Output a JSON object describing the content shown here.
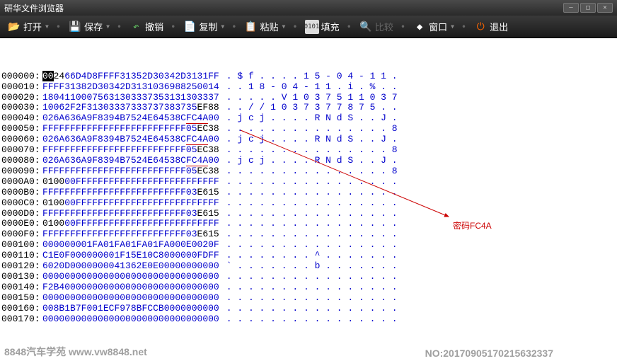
{
  "window": {
    "title": "研华文件浏览器"
  },
  "toolbar": {
    "open": "打开",
    "save": "保存",
    "undo": "撤销",
    "copy": "复制",
    "paste": "粘贴",
    "fill": "填充",
    "compare": "比较",
    "window": "窗口",
    "exit": "退出"
  },
  "annotation": {
    "label": "密码FC4A"
  },
  "watermarks": {
    "left": "8848汽车学苑  www.vw8848.net",
    "right": "NO:20170905170215632337"
  },
  "hex": {
    "rows": [
      {
        "off": "000000:",
        "b": [
          "0024",
          "66D4",
          "D8FF",
          "FF31",
          "352D",
          "3034",
          "2D31",
          "31FF"
        ],
        "a": ".$f....15-04-11."
      },
      {
        "off": "000010:",
        "b": [
          "FFFF",
          "3138",
          "2D30",
          "342D",
          "3131",
          "0369",
          "8825",
          "0014"
        ],
        "a": "..18-04-11.i.%.."
      },
      {
        "off": "000020:",
        "b": [
          "1804",
          "1100",
          "0756",
          "3130",
          "3337",
          "3531",
          "3130",
          "3337"
        ],
        "a": ".....V1037511037"
      },
      {
        "off": "000030:",
        "b": [
          "1006",
          "2F2F",
          "3130",
          "3337",
          "3337",
          "3738",
          "3735",
          "EF88"
        ],
        "a": "..//1037377875.."
      },
      {
        "off": "000040:",
        "b": [
          "026A",
          "636A",
          "9F83",
          "94B7",
          "524E",
          "6453",
          "8CFC",
          "4A00"
        ],
        "a": ".jcj....RNdS..J."
      },
      {
        "off": "000050:",
        "b": [
          "FFFF",
          "FFFF",
          "FFFF",
          "FFFF",
          "FFFF",
          "FFFF",
          "FF05",
          "EC38"
        ],
        "a": "...............8"
      },
      {
        "off": "000060:",
        "b": [
          "026A",
          "636A",
          "9F83",
          "94B7",
          "524E",
          "6453",
          "8CFC",
          "4A00"
        ],
        "a": ".jcj....RNdS..J."
      },
      {
        "off": "000070:",
        "b": [
          "FFFF",
          "FFFF",
          "FFFF",
          "FFFF",
          "FFFF",
          "FFFF",
          "FF05",
          "EC38"
        ],
        "a": "...............8"
      },
      {
        "off": "000080:",
        "b": [
          "026A",
          "636A",
          "9F83",
          "94B7",
          "524E",
          "6453",
          "8CFC",
          "4A00"
        ],
        "a": ".jcj....RNdS..J."
      },
      {
        "off": "000090:",
        "b": [
          "FFFF",
          "FFFF",
          "FFFF",
          "FFFF",
          "FFFF",
          "FFFF",
          "FF05",
          "EC38"
        ],
        "a": "...............8"
      },
      {
        "off": "0000A0:",
        "b": [
          "0100",
          "00FF",
          "FFFF",
          "FFFF",
          "FFFF",
          "FFFF",
          "FFFF",
          "FFFF"
        ],
        "a": "................"
      },
      {
        "off": "0000B0:",
        "b": [
          "FFFF",
          "FFFF",
          "FFFF",
          "FFFF",
          "FFFF",
          "FFFF",
          "FF03",
          "E615"
        ],
        "a": "................"
      },
      {
        "off": "0000C0:",
        "b": [
          "0100",
          "00FF",
          "FFFF",
          "FFFF",
          "FFFF",
          "FFFF",
          "FFFF",
          "FFFF"
        ],
        "a": "................"
      },
      {
        "off": "0000D0:",
        "b": [
          "FFFF",
          "FFFF",
          "FFFF",
          "FFFF",
          "FFFF",
          "FFFF",
          "FF03",
          "E615"
        ],
        "a": "................"
      },
      {
        "off": "0000E0:",
        "b": [
          "0100",
          "00FF",
          "FFFF",
          "FFFF",
          "FFFF",
          "FFFF",
          "FFFF",
          "FFFF"
        ],
        "a": "................"
      },
      {
        "off": "0000F0:",
        "b": [
          "FFFF",
          "FFFF",
          "FFFF",
          "FFFF",
          "FFFF",
          "FFFF",
          "FF03",
          "E615"
        ],
        "a": "................"
      },
      {
        "off": "000100:",
        "b": [
          "0000",
          "0000",
          "1FA0",
          "1FA0",
          "1FA0",
          "1FA0",
          "00E0",
          "020F"
        ],
        "a": "................"
      },
      {
        "off": "000110:",
        "b": [
          "C1E0",
          "F000",
          "0000",
          "01F1",
          "5E10",
          "C800",
          "0000",
          "FDFF"
        ],
        "a": "........^......."
      },
      {
        "off": "000120:",
        "b": [
          "6020",
          "D000",
          "0000",
          "0413",
          "62E0",
          "E000",
          "0000",
          "0000"
        ],
        "a": "`.......b......."
      },
      {
        "off": "000130:",
        "b": [
          "0000",
          "0000",
          "0000",
          "0000",
          "0000",
          "0000",
          "0000",
          "0000"
        ],
        "a": "................"
      },
      {
        "off": "000140:",
        "b": [
          "F2B4",
          "0000",
          "0000",
          "0000",
          "0000",
          "0000",
          "0000",
          "0000"
        ],
        "a": "................"
      },
      {
        "off": "000150:",
        "b": [
          "0000",
          "0000",
          "0000",
          "0000",
          "0000",
          "0000",
          "0000",
          "0000"
        ],
        "a": "................"
      },
      {
        "off": "000160:",
        "b": [
          "008B",
          "1B7F",
          "001E",
          "CF97",
          "8BFC",
          "CB00",
          "0000",
          "0000"
        ],
        "a": "................"
      },
      {
        "off": "000170:",
        "b": [
          "0000",
          "0000",
          "0000",
          "0000",
          "0000",
          "0000",
          "0000",
          "0000"
        ],
        "a": "................"
      }
    ],
    "black_bytes": {
      "0": [
        0
      ],
      "3": [
        7
      ],
      "5": [
        7
      ],
      "7": [
        7
      ],
      "9": [
        7
      ],
      "10": [
        0
      ],
      "11": [
        7
      ],
      "12": [
        0
      ],
      "13": [
        7
      ],
      "14": [
        0
      ],
      "15": [
        7
      ]
    }
  }
}
